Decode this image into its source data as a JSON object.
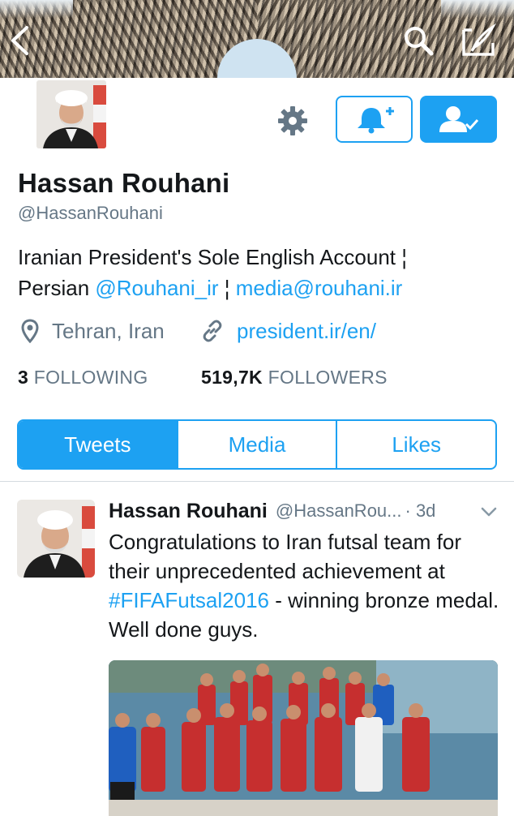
{
  "header": {
    "back_icon": "chevron-left-icon",
    "search_icon": "search-icon",
    "compose_icon": "compose-icon"
  },
  "profile": {
    "name": "Hassan Rouhani",
    "handle": "@HassanRouhani",
    "bio_text_1": "Iranian President's Sole English Account ¦",
    "bio_text_2": "Persian ",
    "bio_mention": "@Rouhani_ir",
    "bio_separator": " ¦ ",
    "bio_email": "media@rouhani.ir",
    "location": "Tehran, Iran",
    "website": "president.ir/en/",
    "following_count": "3",
    "following_label": "FOLLOWING",
    "followers_count": "519,7K",
    "followers_label": "FOLLOWERS"
  },
  "actions": {
    "settings_icon": "gear-icon",
    "notify_icon": "bell-plus-icon",
    "following_icon": "person-check-icon"
  },
  "tabs": [
    {
      "label": "Tweets",
      "active": true
    },
    {
      "label": "Media",
      "active": false
    },
    {
      "label": "Likes",
      "active": false
    }
  ],
  "tweet": {
    "name": "Hassan Rouhani",
    "handle": "@HassanRou...",
    "time": "· 3d",
    "text_1": "Congratulations to Iran futsal team for their unprecedented achievement at ",
    "hashtag": "#FIFAFutsal2016",
    "text_2": " - winning bronze medal. Well done guys.",
    "caret_icon": "chevron-down-icon"
  },
  "colors": {
    "accent": "#1da1f2",
    "secondary_text": "#657786",
    "primary_text": "#14171a"
  }
}
